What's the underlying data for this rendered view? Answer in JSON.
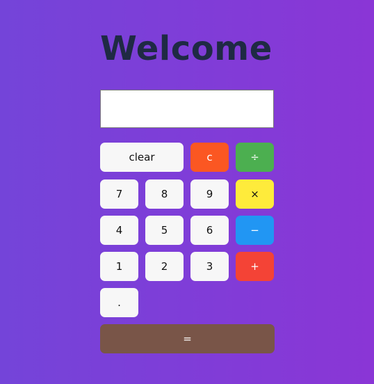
{
  "header": {
    "title": "Welcome"
  },
  "display": {
    "value": ""
  },
  "buttons": {
    "clear": "clear",
    "c": "c",
    "divide": "÷",
    "multiply": "×",
    "subtract": "−",
    "add": "+",
    "equals": "=",
    "decimal": ".",
    "digits": {
      "d7": "7",
      "d8": "8",
      "d9": "9",
      "d4": "4",
      "d5": "5",
      "d6": "6",
      "d1": "1",
      "d2": "2",
      "d3": "3"
    }
  },
  "colors": {
    "background_start": "#7444d9",
    "background_end": "#8a36d6",
    "title": "#1f2a44",
    "c": "#fb5722",
    "divide": "#4caf50",
    "multiply": "#feeb3b",
    "subtract": "#2196f3",
    "add": "#f44336",
    "equals": "#795548"
  }
}
